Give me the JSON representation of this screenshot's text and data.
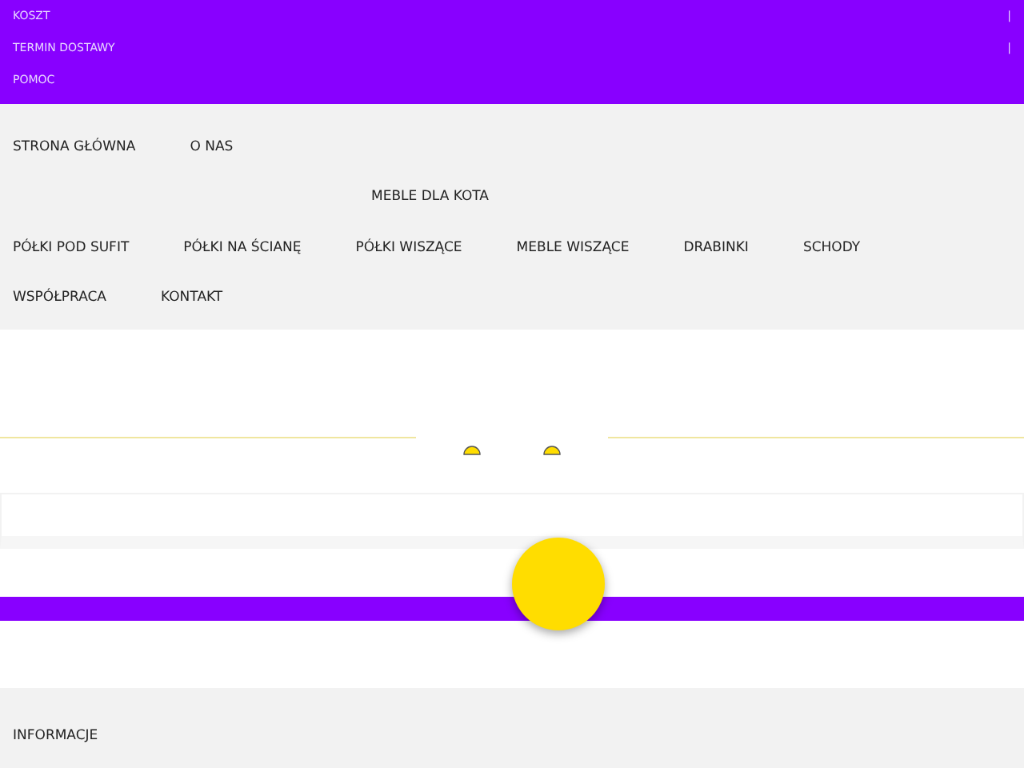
{
  "top_bar": {
    "items": [
      {
        "label": "KOSZT",
        "separator": "|"
      },
      {
        "label": "TERMIN DOSTAWY",
        "separator": "|"
      },
      {
        "label": "POMOC"
      }
    ]
  },
  "nav": {
    "rows": [
      {
        "items": [
          "STRONA GŁÓWNA",
          "O NAS"
        ]
      },
      {
        "items": [
          "MEBLE DLA KOTA"
        ]
      },
      {
        "items": [
          "PÓŁKI POD SUFIT",
          "PÓŁKI NA ŚCIANĘ",
          "PÓŁKI WISZĄCE",
          "MEBLE WISZĄCE",
          "DRABINKI",
          "SCHODY"
        ]
      },
      {
        "items": [
          "WSPÓŁPRACA",
          "KONTAKT"
        ]
      }
    ]
  },
  "footer": {
    "heading": "INFORMACJE"
  }
}
